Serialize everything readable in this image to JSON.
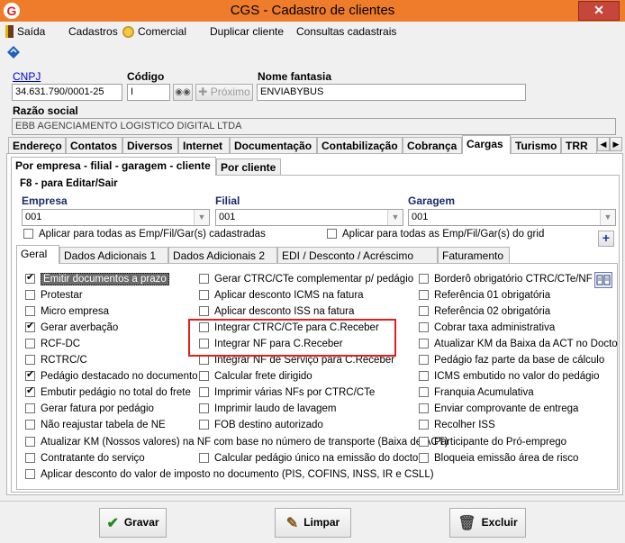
{
  "window": {
    "title": "CGS - Cadastro de clientes",
    "close_symbol": "✕"
  },
  "menu": {
    "saida": "Saída",
    "cadastros": "Cadastros",
    "comercial": "Comercial",
    "duplicar": "Duplicar cliente",
    "consultas": "Consultas cadastrais"
  },
  "header": {
    "cnpj_label": "CNPJ",
    "cnpj_value": "34.631.790/0001-25",
    "codigo_label": "Código",
    "codigo_value": "I",
    "proximo_label": "Próximo",
    "nome_fantasia_label": "Nome fantasia",
    "nome_fantasia_value": "ENVIABYBUS",
    "razao_label": "Razão social",
    "razao_value": "EBB AGENCIAMENTO LOGISTICO DIGITAL LTDA"
  },
  "main_tabs": [
    "Endereço",
    "Contatos",
    "Diversos",
    "Internet",
    "Documentação",
    "Contabilização",
    "Cobrança",
    "Cargas",
    "Turismo",
    "TRR"
  ],
  "sub_tabs": [
    "Por empresa - filial - garagem - cliente",
    "Por cliente"
  ],
  "f8_label": "F8 - para Editar/Sair",
  "selectors": {
    "empresa_label": "Empresa",
    "empresa_value": "001",
    "filial_label": "Filial",
    "filial_value": "001",
    "garagem_label": "Garagem",
    "garagem_value": "001",
    "aplicar_emp": "Aplicar para todas as Emp/Fil/Gar(s) cadastradas",
    "aplicar_grid": "Aplicar para todas as Emp/Fil/Gar(s) do grid",
    "plus": "+"
  },
  "inner_tabs": [
    "Geral",
    "Dados Adicionais 1",
    "Dados Adicionais 2",
    "EDI / Desconto / Acréscimo",
    "Faturamento"
  ],
  "checkboxes": {
    "col1": [
      {
        "label": "Emitir documentos a prazo",
        "checked": true
      },
      {
        "label": "Protestar",
        "checked": false
      },
      {
        "label": "Micro empresa",
        "checked": false
      },
      {
        "label": "Gerar averbação",
        "checked": true
      },
      {
        "label": "RCF-DC",
        "checked": false
      },
      {
        "label": "RCTRC/C",
        "checked": false
      },
      {
        "label": "Pedágio destacado no documento",
        "checked": true
      },
      {
        "label": "Embutir pedágio no total do frete",
        "checked": true
      },
      {
        "label": "Gerar fatura por pedágio",
        "checked": false
      },
      {
        "label": "Não reajustar tabela de NE",
        "checked": false
      }
    ],
    "col2": [
      {
        "label": "Gerar CTRC/CTe complementar p/ pedágio",
        "checked": false
      },
      {
        "label": "Aplicar desconto ICMS na fatura",
        "checked": false
      },
      {
        "label": "Aplicar desconto ISS na fatura",
        "checked": false
      },
      {
        "label": "Integrar CTRC/CTe para C.Receber",
        "checked": false
      },
      {
        "label": "Integrar NF para C.Receber",
        "checked": false
      },
      {
        "label": "Integrar NF de Serviço para C.Receber",
        "checked": false
      },
      {
        "label": "Calcular frete dirigido",
        "checked": false
      },
      {
        "label": "Imprimir várias NFs por CTRC/CTe",
        "checked": false
      },
      {
        "label": "Imprimir laudo de lavagem",
        "checked": false
      },
      {
        "label": "FOB destino autorizado",
        "checked": false
      }
    ],
    "col3": [
      {
        "label": "Borderô obrigatório  CTRC/CTe/NF",
        "checked": false
      },
      {
        "label": "Referência 01 obrigatória",
        "checked": false
      },
      {
        "label": "Referência 02 obrigatória",
        "checked": false
      },
      {
        "label": "Cobrar taxa administrativa",
        "checked": false
      },
      {
        "label": "Atualizar KM da Baixa da ACT no Docto",
        "checked": false
      },
      {
        "label": "Pedágio faz parte da base de cálculo",
        "checked": false
      },
      {
        "label": "ICMS embutido no valor do pedágio",
        "checked": false
      },
      {
        "label": "Franquia Acumulativa",
        "checked": false
      },
      {
        "label": "Enviar comprovante de entrega",
        "checked": false
      },
      {
        "label": "Recolher ISS",
        "checked": false
      }
    ],
    "wide1": "Atualizar KM (Nossos valores) na NF com base no número de transporte (Baixa de ACT)",
    "participante": "Participante do Pró-emprego",
    "contratante": "Contratante do serviço",
    "calcular_pedagio": "Calcular pedágio único na emissão do docto",
    "bloqueia": "Bloqueia emissão área de risco",
    "aplicar_desconto": "Aplicar desconto do valor de imposto no documento (PIS, COFINS, INSS, IR e CSLL)"
  },
  "buttons": {
    "gravar": "Gravar",
    "limpar": "Limpar",
    "excluir": "Excluir"
  },
  "colors": {
    "titlebar": "#ef7c2b",
    "highlight": "#e02020",
    "selected": "#6a6a6a"
  }
}
